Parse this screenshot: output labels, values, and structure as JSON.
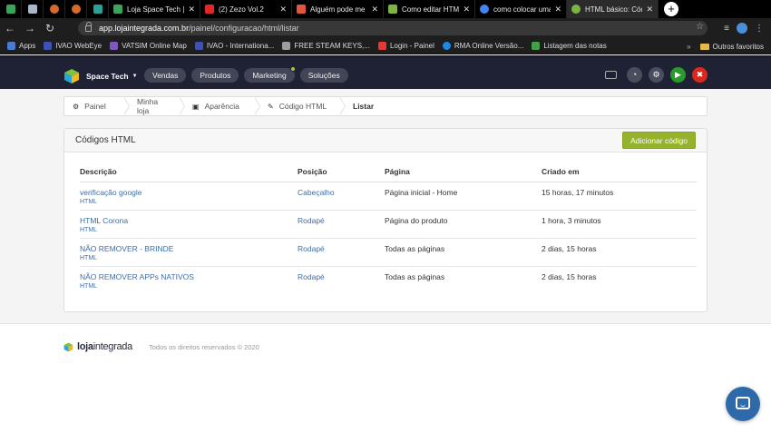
{
  "browser": {
    "tabs": [
      {
        "title": "",
        "pinned": true,
        "color": "#e5543c"
      },
      {
        "title": "",
        "pinned": true,
        "color": "#aab7c9"
      },
      {
        "title": "",
        "pinned": true,
        "color": "#d56a2a"
      },
      {
        "title": "",
        "pinned": true,
        "color": "#d56a2a"
      },
      {
        "title": "",
        "pinned": true,
        "color": "#2aa198"
      },
      {
        "title": "Loja Space Tech |",
        "pinned": false,
        "color": "#3aa55a"
      },
      {
        "title": "(2) Zezo Vol.2",
        "pinned": false,
        "color": "#e32626"
      },
      {
        "title": "Alguém pode me",
        "pinned": false,
        "color": "#e5543c"
      },
      {
        "title": "Como editar HTM",
        "pinned": false,
        "color": "#7cb342"
      },
      {
        "title": "como colocar uma",
        "pinned": false,
        "color": "#4285f4"
      },
      {
        "title": "HTML básico: Cód",
        "pinned": false,
        "color": "#7cb342",
        "active": true
      }
    ],
    "url_host": "app.lojaintegrada.com.br",
    "url_path": "/painel/configuracao/html/listar",
    "bookmarks": [
      {
        "label": "Apps",
        "color": "#4a7bd0"
      },
      {
        "label": "IVAO WebEye",
        "color": "#3f51b5"
      },
      {
        "label": "VATSIM Online Map",
        "color": "#7e57c2"
      },
      {
        "label": "IVAO - Internationa...",
        "color": "#3f51b5"
      },
      {
        "label": "FREE STEAM KEYS,...",
        "color": "#9e9e9e"
      },
      {
        "label": "Login - Painel",
        "color": "#e53935"
      },
      {
        "label": "RMA Online Versão...",
        "color": "#1e88e5"
      },
      {
        "label": "Listagem das notas",
        "color": "#43a047"
      }
    ],
    "other_bookmarks": "Outros favoritos"
  },
  "header": {
    "brand": "Space Tech",
    "menu": [
      "Vendas",
      "Produtos",
      "Marketing",
      "Soluções"
    ]
  },
  "breadcrumb": [
    "Painel",
    "Minha loja",
    "Aparência",
    "Código HTML",
    "Listar"
  ],
  "panel": {
    "title": "Códigos HTML",
    "add_button": "Adicionar código",
    "columns": [
      "Descrição",
      "Posição",
      "Página",
      "Criado em"
    ],
    "rows": [
      {
        "desc": "verificação google",
        "type": "HTML",
        "pos": "Cabeçalho",
        "page": "Página inicial - Home",
        "created": "15 horas, 17 minutos"
      },
      {
        "desc": "HTML Corona",
        "type": "HTML",
        "pos": "Rodapé",
        "page": "Página do produto",
        "created": "1 hora, 3 minutos"
      },
      {
        "desc": "NÃO REMOVER - BRINDE",
        "type": "HTML",
        "pos": "Rodapé",
        "page": "Todas as páginas",
        "created": "2 dias, 15 horas"
      },
      {
        "desc": "NÃO REMOVER APPs NATIVOS",
        "type": "HTML",
        "pos": "Rodapé",
        "page": "Todas as páginas",
        "created": "2 dias, 15 horas"
      }
    ]
  },
  "footer": {
    "logo_strong": "loja",
    "logo_light": "integrada",
    "copyright": "Todos os direitos reservados © 2020"
  }
}
